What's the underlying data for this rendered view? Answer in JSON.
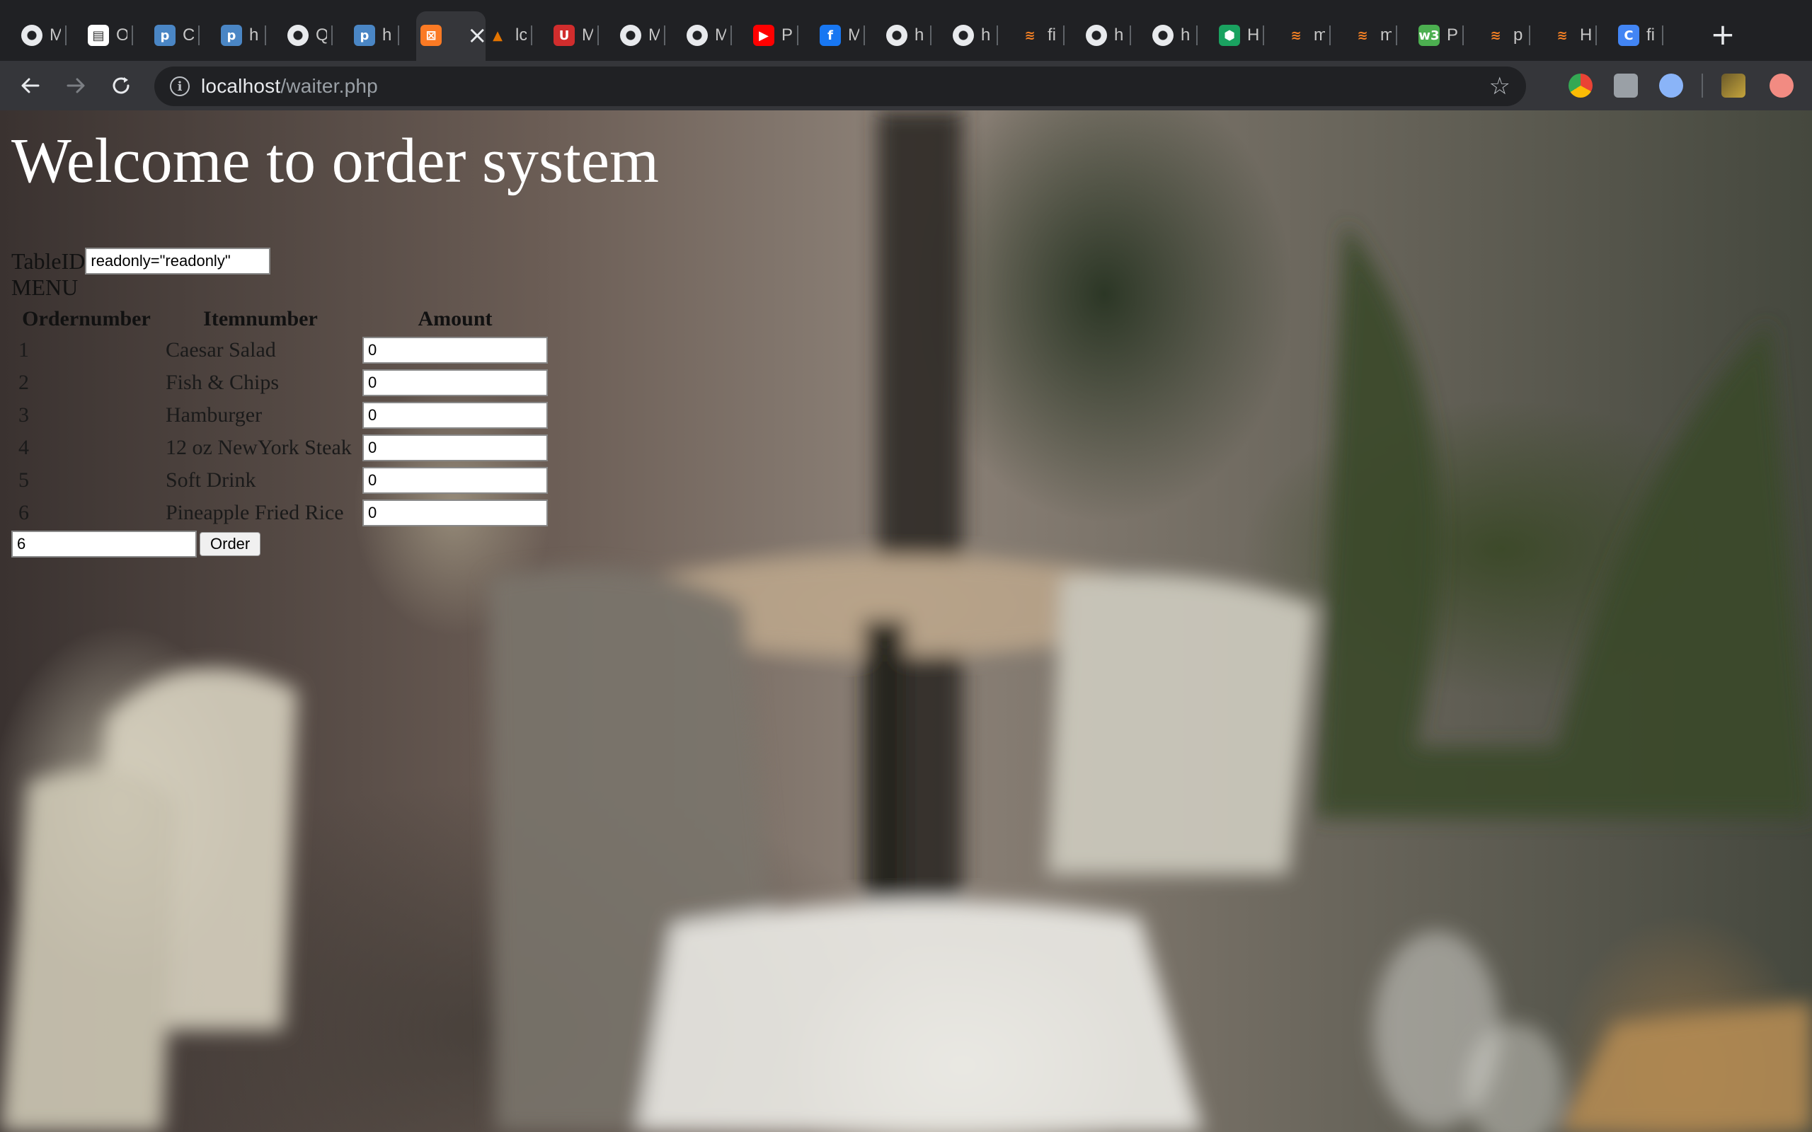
{
  "tabs": [
    {
      "title": "M",
      "icon": "globe-icon",
      "color": "#e8eaed"
    },
    {
      "title": "O",
      "icon": "document-icon",
      "color": "#ffffff"
    },
    {
      "title": "C",
      "icon": "p-logo-icon",
      "color": "#4a86c5"
    },
    {
      "title": "h",
      "icon": "p-logo-icon",
      "color": "#4a86c5"
    },
    {
      "title": "Q",
      "icon": "globe-icon",
      "color": "#e8eaed"
    },
    {
      "title": "h",
      "icon": "p-logo-icon",
      "color": "#4a86c5"
    },
    {
      "title": "",
      "icon": "xampp-icon",
      "color": "#fb7a24",
      "active": true
    },
    {
      "title": "lc",
      "icon": "mountain-icon",
      "color": "#e37400"
    },
    {
      "title": "M",
      "icon": "ubc-canvas-icon",
      "color": "#d12d2d"
    },
    {
      "title": "M",
      "icon": "globe-icon",
      "color": "#e8eaed"
    },
    {
      "title": "M",
      "icon": "globe-icon",
      "color": "#e8eaed"
    },
    {
      "title": "P",
      "icon": "youtube-icon",
      "color": "#ff0000"
    },
    {
      "title": "M",
      "icon": "facebook-icon",
      "color": "#1877f2"
    },
    {
      "title": "h",
      "icon": "globe-icon",
      "color": "#e8eaed"
    },
    {
      "title": "h",
      "icon": "globe-icon",
      "color": "#e8eaed"
    },
    {
      "title": "fi",
      "icon": "stackoverflow-icon",
      "color": "#f48024"
    },
    {
      "title": "h",
      "icon": "globe-icon",
      "color": "#e8eaed"
    },
    {
      "title": "h",
      "icon": "globe-icon",
      "color": "#e8eaed"
    },
    {
      "title": "H",
      "icon": "hex-icon",
      "color": "#1aa260"
    },
    {
      "title": "m",
      "icon": "stackoverflow-icon",
      "color": "#f48024"
    },
    {
      "title": "m",
      "icon": "stackoverflow-icon",
      "color": "#f48024"
    },
    {
      "title": "P",
      "icon": "w3-icon",
      "color": "#4caf50"
    },
    {
      "title": "p",
      "icon": "stackoverflow-icon",
      "color": "#f48024"
    },
    {
      "title": "H",
      "icon": "stackoverflow-icon",
      "color": "#f48024"
    },
    {
      "title": "fi",
      "icon": "css-logo-icon",
      "color": "#4285f4"
    }
  ],
  "browser": {
    "url_host": "localhost",
    "url_path": "/waiter.php",
    "new_tab": "+",
    "close_tab": "×",
    "back": "←",
    "forward": "→",
    "reload": "⟳",
    "info": "i",
    "star": "☆"
  },
  "page": {
    "title": "Welcome to order system",
    "tableid_label": "TableID",
    "tableid_value": "readonly=\"readonly\"",
    "menu_label": "MENU",
    "columns": [
      "Ordernumber",
      "Itemnumber",
      "Amount"
    ],
    "items": [
      {
        "number": "1",
        "name": "Caesar Salad",
        "amount": "0"
      },
      {
        "number": "2",
        "name": "Fish & Chips",
        "amount": "0"
      },
      {
        "number": "3",
        "name": "Hamburger",
        "amount": "0"
      },
      {
        "number": "4",
        "name": "12 oz NewYork Steak",
        "amount": "0"
      },
      {
        "number": "5",
        "name": "Soft Drink",
        "amount": "0"
      },
      {
        "number": "6",
        "name": "Pineapple Fried Rice",
        "amount": "0"
      }
    ],
    "order_count_value": "6",
    "order_button": "Order"
  }
}
